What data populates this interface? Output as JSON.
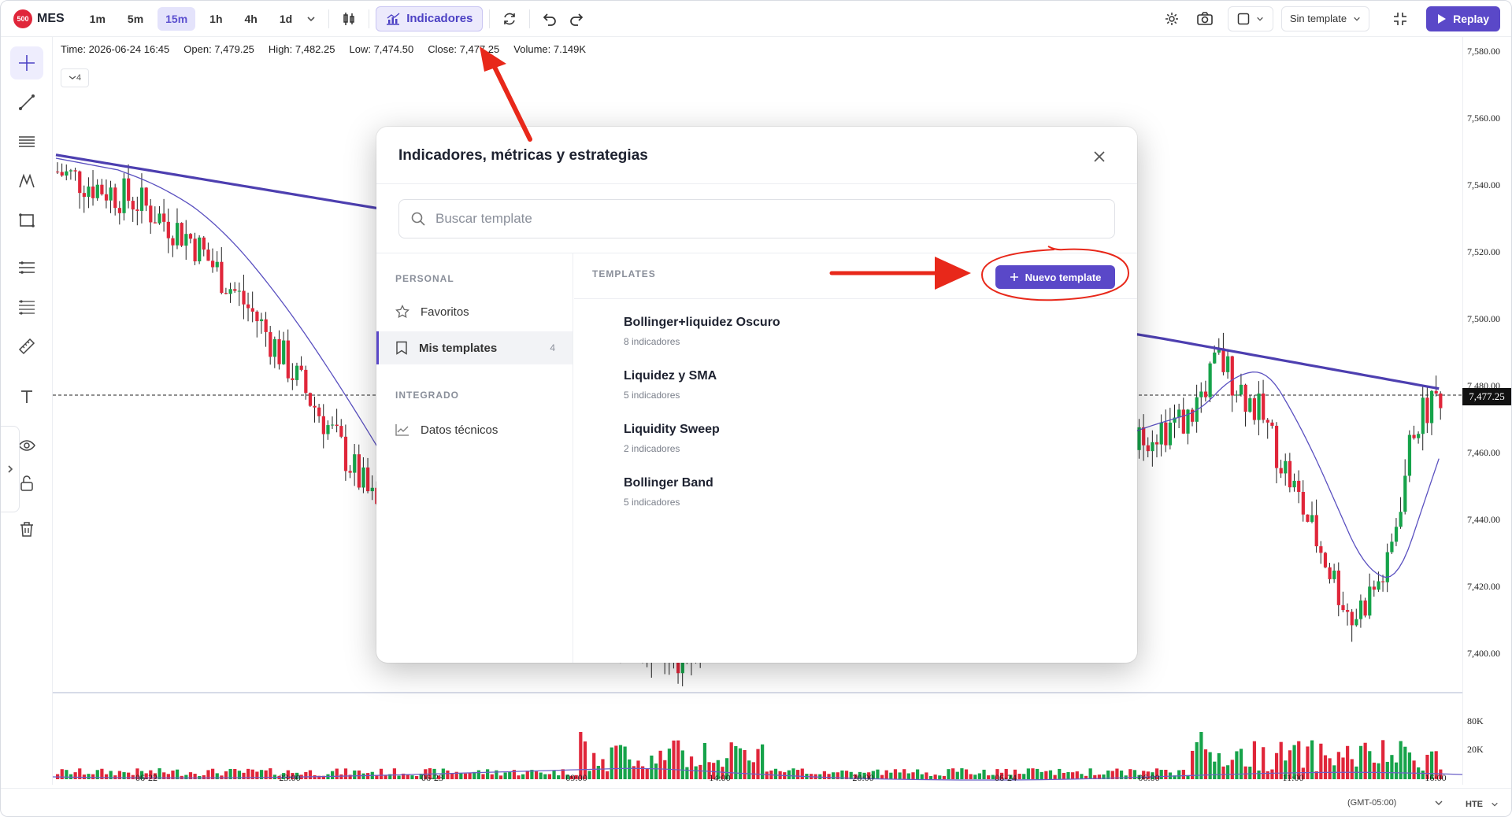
{
  "symbol": {
    "badge": "500",
    "name": "MES"
  },
  "timeframes": [
    {
      "label": "1m",
      "active": false
    },
    {
      "label": "5m",
      "active": false
    },
    {
      "label": "15m",
      "active": true
    },
    {
      "label": "1h",
      "active": false
    },
    {
      "label": "4h",
      "active": false
    },
    {
      "label": "1d",
      "active": false
    }
  ],
  "toolbar": {
    "indicators_label": "Indicadores",
    "template_select": "Sin template",
    "replay_label": "Replay"
  },
  "ohlc": {
    "time": "Time: 2026-06-24 16:45",
    "open": "Open: 7,479.25",
    "high": "High: 7,482.25",
    "low": "Low: 7,474.50",
    "close": "Close: 7,477.25",
    "volume": "Volume: 7.149K"
  },
  "indicator_chip": "4",
  "price_axis": [
    "7,580.00",
    "7,560.00",
    "7,540.00",
    "7,520.00",
    "7,500.00",
    "7,480.00",
    "7,460.00",
    "7,440.00",
    "7,420.00",
    "7,400.00"
  ],
  "current_price": "7,477.25",
  "volume_axis": [
    "80K",
    "20K"
  ],
  "time_axis": [
    "06-22",
    "23:00",
    "06-23",
    "09:00",
    "14:00",
    "20:00",
    "06-24",
    "06:00",
    "11:00",
    "16:00"
  ],
  "footer": {
    "timezone": "(GMT-05:00)",
    "mode": "HTE"
  },
  "modal": {
    "title": "Indicadores, métricas y estrategias",
    "search_placeholder": "Buscar template",
    "sections": {
      "personal": "PERSONAL",
      "integrado": "INTEGRADO"
    },
    "nav": {
      "favoritos": "Favoritos",
      "mis_templates": "Mis templates",
      "mis_templates_count": "4",
      "datos_tecnicos": "Datos técnicos"
    },
    "templates_header": "TEMPLATES",
    "new_template": "Nuevo template",
    "templates": [
      {
        "name": "Bollinger+liquidez Oscuro",
        "count": "8 indicadores"
      },
      {
        "name": "Liquidez y SMA",
        "count": "5 indicadores"
      },
      {
        "name": "Liquidity Sweep",
        "count": "2 indicadores"
      },
      {
        "name": "Bollinger Band",
        "count": "5 indicadores"
      }
    ]
  },
  "colors": {
    "accent": "#5a48c8",
    "bull": "#16a34a",
    "bear": "#e0263a",
    "annotation": "#e8281a"
  }
}
